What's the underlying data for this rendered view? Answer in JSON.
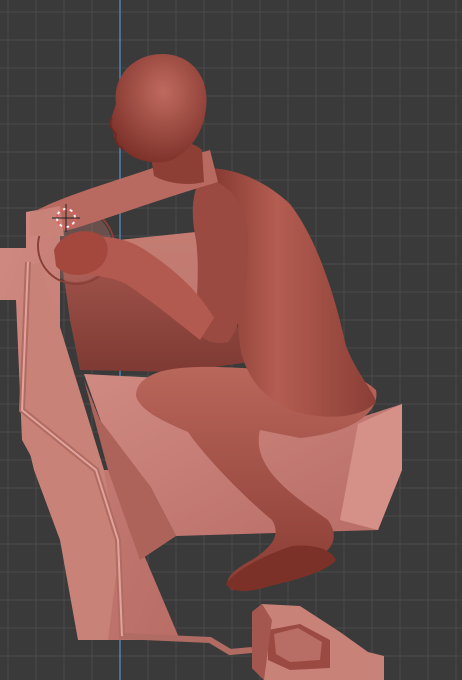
{
  "viewport": {
    "mode": "3d-viewport",
    "view": "side-orthographic",
    "background_color": "#3a3a3a",
    "grid_color": "#4a4a4a",
    "axis_line_color": "#4f7fb3",
    "model_base_color": "#c27a73",
    "model_shadow_color": "#8a3f37",
    "figure_color": "#9a4a40",
    "cursor_color": "#e06060",
    "objects": [
      {
        "name": "mannequin-figure",
        "kind": "posed-human-mannequin"
      },
      {
        "name": "car-seat",
        "kind": "seat-mesh"
      },
      {
        "name": "steering-wheel",
        "kind": "circle-wire"
      },
      {
        "name": "pedal",
        "kind": "pedal-mesh"
      }
    ],
    "cursor": {
      "name": "3d-cursor-icon"
    }
  }
}
